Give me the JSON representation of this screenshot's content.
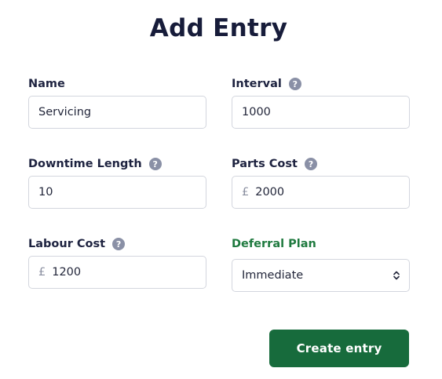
{
  "page": {
    "title": "Add Entry"
  },
  "form": {
    "name": {
      "label": "Name",
      "value": "Servicing"
    },
    "interval": {
      "label": "Interval",
      "value": "1000",
      "help": "?"
    },
    "downtime_length": {
      "label": "Downtime Length",
      "value": "10",
      "help": "?"
    },
    "parts_cost": {
      "label": "Parts Cost",
      "currency": "£",
      "value": "2000",
      "help": "?"
    },
    "labour_cost": {
      "label": "Labour Cost",
      "currency": "£",
      "value": "1200",
      "help": "?"
    },
    "deferral_plan": {
      "label": "Deferral Plan",
      "selected": "Immediate"
    },
    "submit_label": "Create entry"
  },
  "colors": {
    "accent": "#176b3c",
    "deferral_label": "#1f7a3f",
    "help_icon": "#8a90a6"
  },
  "icons": {
    "help": "question-circle-icon",
    "select": "up-down-chevron-icon"
  }
}
